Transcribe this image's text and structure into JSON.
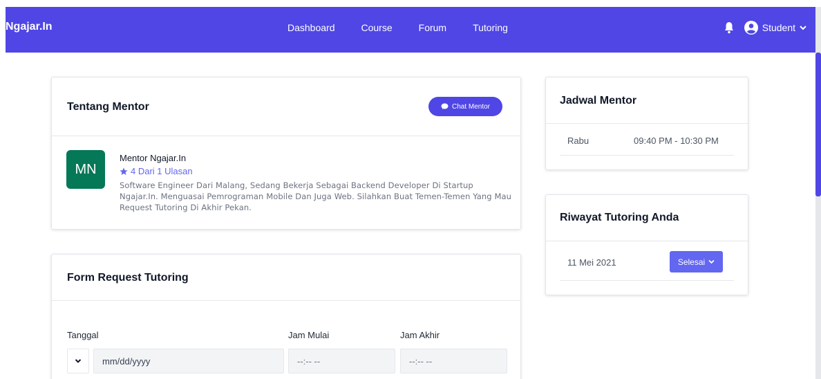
{
  "nav": {
    "brand": "Ngajar.In",
    "links": [
      "Dashboard",
      "Course",
      "Forum",
      "Tutoring"
    ],
    "user": "Student",
    "accent": "#4f46e5"
  },
  "about": {
    "title": "Tentang Mentor",
    "chat_button": "Chat Mentor",
    "avatar_initials": "MN",
    "mentor_name": "Mentor Ngajar.In",
    "rating_text": "4 Dari 1 Ulasan",
    "bio": "Software Engineer Dari Malang, Sedang Bekerja Sebagai Backend Developer Di Startup Ngajar.In. Menguasai Pemrograman Mobile Dan Juga Web. Silahkan Buat Temen-Temen Yang Mau Request Tutoring Di Akhir Pekan."
  },
  "form": {
    "title": "Form Request Tutoring",
    "date_label": "Tanggal",
    "date_placeholder": "mm/dd/yyyy",
    "start_label": "Jam Mulai",
    "start_placeholder": "--:-- --",
    "end_label": "Jam Akhir",
    "end_placeholder": "--:-- --"
  },
  "schedule": {
    "title": "Jadwal Mentor",
    "rows": [
      {
        "day": "Rabu",
        "time": "09:40 PM - 10:30 PM"
      }
    ]
  },
  "history": {
    "title": "Riwayat Tutoring Anda",
    "rows": [
      {
        "date": "11 Mei 2021",
        "status": "Selesai"
      }
    ]
  }
}
